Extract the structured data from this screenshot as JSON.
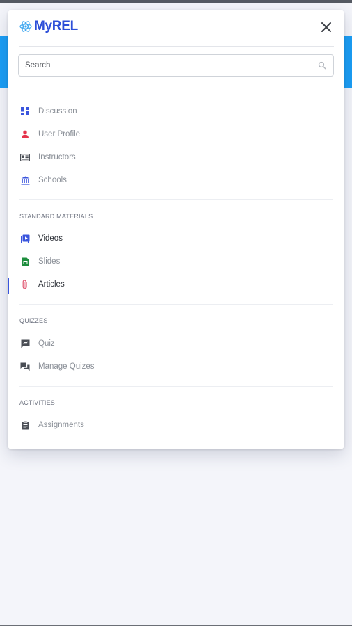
{
  "app": {
    "name": "MyREL"
  },
  "search": {
    "placeholder": "Search"
  },
  "menu": {
    "items": [
      {
        "label": "Discussion",
        "icon": "dashboard-icon"
      },
      {
        "label": "User Profile",
        "icon": "user-icon"
      },
      {
        "label": "Instructors",
        "icon": "id-card-icon"
      },
      {
        "label": "Schools",
        "icon": "institution-icon"
      }
    ],
    "sections": [
      {
        "title": "STANDARD MATERIALS",
        "items": [
          {
            "label": "Videos",
            "icon": "video-icon"
          },
          {
            "label": "Slides",
            "icon": "slides-icon"
          },
          {
            "label": "Articles",
            "icon": "paperclip-icon",
            "active": true
          }
        ]
      },
      {
        "title": "QUIZZES",
        "items": [
          {
            "label": "Quiz",
            "icon": "quiz-icon"
          },
          {
            "label": "Manage Quizes",
            "icon": "chat-icon"
          }
        ]
      },
      {
        "title": "ACTIVITIES",
        "items": [
          {
            "label": "Assignments",
            "icon": "clipboard-icon"
          }
        ]
      }
    ]
  },
  "colors": {
    "brand": "#2d4fd8",
    "header_bar": "#1a9ef5",
    "active_indicator": "#3a55dd",
    "user_icon": "#e5334b",
    "slides_icon": "#1e8e3e",
    "articles_icon": "#e0556f"
  }
}
